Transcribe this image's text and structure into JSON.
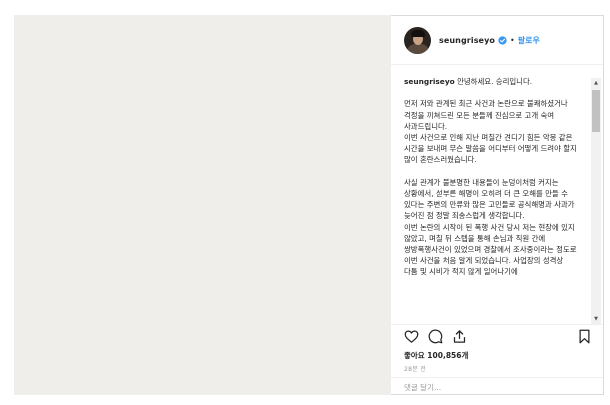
{
  "post": {
    "username": "seungriseyo",
    "follow_label": "팔로우",
    "separator": "•",
    "caption_username": "seungriseyo",
    "caption_text": " 안녕하세요. 승리입니다.\n\n먼저 저와 관계된 최근 사건과 논란으로 불쾌하셨거나 걱정을 끼쳐드린 모든 분들께 진심으로 고개 숙여 사과드립니다.\n이번 사건으로 인해 지난 며칠간 견디기 힘든 악몽 같은 시간을 보내며 무슨 말씀을 어디부터 어떻게 드려야 할지 많이 혼란스러웠습니다.\n\n사실 관계가 불분명한 내용들이 눈덩이처럼 커지는 상황에서, 섣부른 해명이 오히려 더 큰 오해를 만들 수 있다는 주변의 만류와 많은 고민들로 공식해명과 사과가 늦어진 점 정말 죄송스럽게 생각합니다.\n이번 논란의 시작이 된 폭행 사건 당시 저는 현장에 있지 않았고, 며칠 뒤 스텝을 통해 손님과 직원 간에 쌍방폭행사건이 있었으며 경찰에서 조사중이라는 정도로 이번 사건을 처음 알게 되었습니다. 사업장의 성격상 다툼 및 시비가 적지 않게 일어나기에",
    "likes_label": "좋아요 100,856개",
    "time_ago": "28분 전",
    "comment_placeholder": "댓글 달기..."
  },
  "icons": {
    "like": "heart-icon",
    "comment": "comment-icon",
    "share": "share-icon",
    "save": "bookmark-icon",
    "verified": "verified-badge-icon"
  },
  "colors": {
    "accent": "#3897f0",
    "media_bg": "#efeeeb",
    "border": "#dbdbdb"
  }
}
